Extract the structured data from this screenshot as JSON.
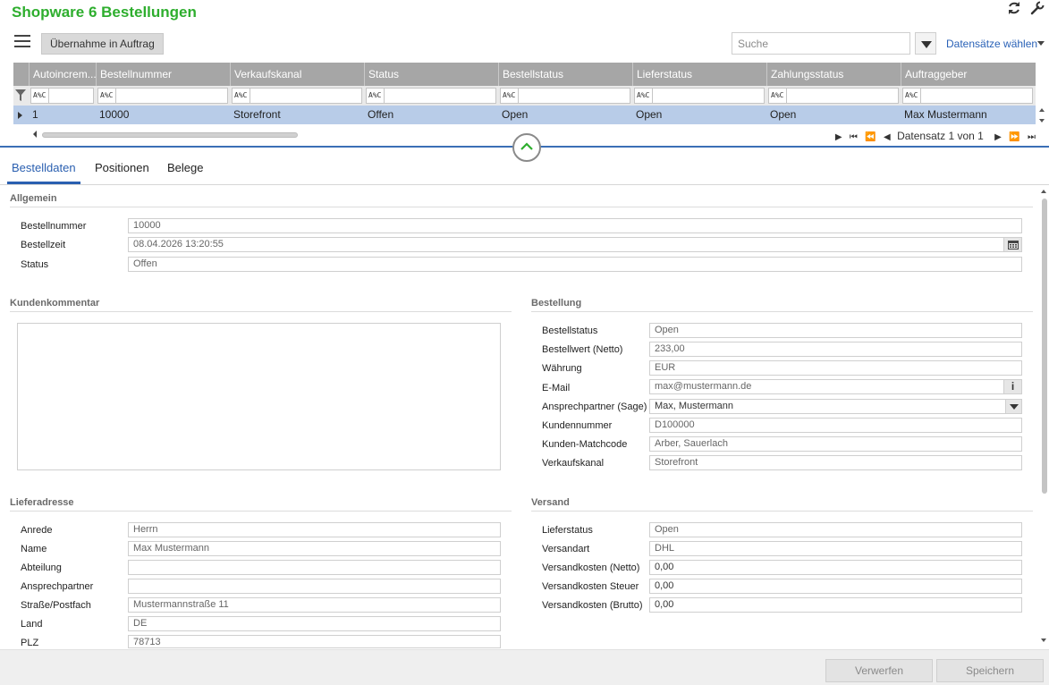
{
  "app": {
    "title": "Shopware 6 Bestellungen"
  },
  "toolbar": {
    "transfer_label": "Übernahme in Auftrag",
    "search_placeholder": "Suche",
    "records_label": "Datensätze wählen"
  },
  "grid": {
    "columns": [
      "Autoincrem...",
      "Bestellnummer",
      "Verkaufskanal",
      "Status",
      "Bestellstatus",
      "Lieferstatus",
      "Zahlungsstatus",
      "Auftraggeber"
    ],
    "filter_op": "A%C",
    "rows": [
      [
        "1",
        "10000",
        "Storefront",
        "Offen",
        "Open",
        "Open",
        "Open",
        "Max Mustermann"
      ]
    ],
    "pager_text": "Datensatz 1 von 1"
  },
  "tabs": [
    "Bestelldaten",
    "Positionen",
    "Belege"
  ],
  "allgemein": {
    "title": "Allgemein",
    "fields": [
      {
        "label": "Bestellnummer",
        "value": "10000"
      },
      {
        "label": "Bestellzeit",
        "value": "08.04.2026 13:20:55"
      },
      {
        "label": "Status",
        "value": "Offen"
      }
    ]
  },
  "kommentar": {
    "title": "Kundenkommentar"
  },
  "bestellung": {
    "title": "Bestellung",
    "fields": [
      {
        "label": "Bestellstatus",
        "value": "Open"
      },
      {
        "label": "Bestellwert (Netto)",
        "value": "233,00"
      },
      {
        "label": "Währung",
        "value": "EUR"
      },
      {
        "label": "E-Mail",
        "value": "max@mustermann.de"
      },
      {
        "label": "Ansprechpartner (Sage)",
        "value": "Max, Mustermann"
      },
      {
        "label": "Kundennummer",
        "value": "D100000"
      },
      {
        "label": "Kunden-Matchcode",
        "value": "Arber, Sauerlach"
      },
      {
        "label": "Verkaufskanal",
        "value": "Storefront"
      }
    ]
  },
  "lieferadresse": {
    "title": "Lieferadresse",
    "fields": [
      {
        "label": "Anrede",
        "value": "Herrn"
      },
      {
        "label": "Name",
        "value": "Max Mustermann"
      },
      {
        "label": "Abteilung",
        "value": ""
      },
      {
        "label": "Ansprechpartner",
        "value": ""
      },
      {
        "label": "Straße/Postfach",
        "value": "Mustermannstraße 11"
      },
      {
        "label": "Land",
        "value": "DE"
      },
      {
        "label": "PLZ",
        "value": "78713"
      }
    ]
  },
  "versand": {
    "title": "Versand",
    "fields": [
      {
        "label": "Lieferstatus",
        "value": "Open"
      },
      {
        "label": "Versandart",
        "value": "DHL"
      },
      {
        "label": "Versandkosten (Netto)",
        "value": "0,00"
      },
      {
        "label": "Versandkosten Steuer",
        "value": "0,00"
      },
      {
        "label": "Versandkosten (Brutto)",
        "value": "0,00"
      }
    ]
  },
  "footer": {
    "discard_label": "Verwerfen",
    "save_label": "Speichern"
  },
  "icons": {
    "refresh": "refresh-icon",
    "wrench": "wrench-icon",
    "menu": "hamburger-menu-icon",
    "calendar": "calendar-icon",
    "info": "info-icon"
  },
  "colors": {
    "title_green": "#2eae2e",
    "accent_blue": "#2a5fb0",
    "selected_row": "#b8cce8",
    "grid_header": "#a6a6a6"
  }
}
